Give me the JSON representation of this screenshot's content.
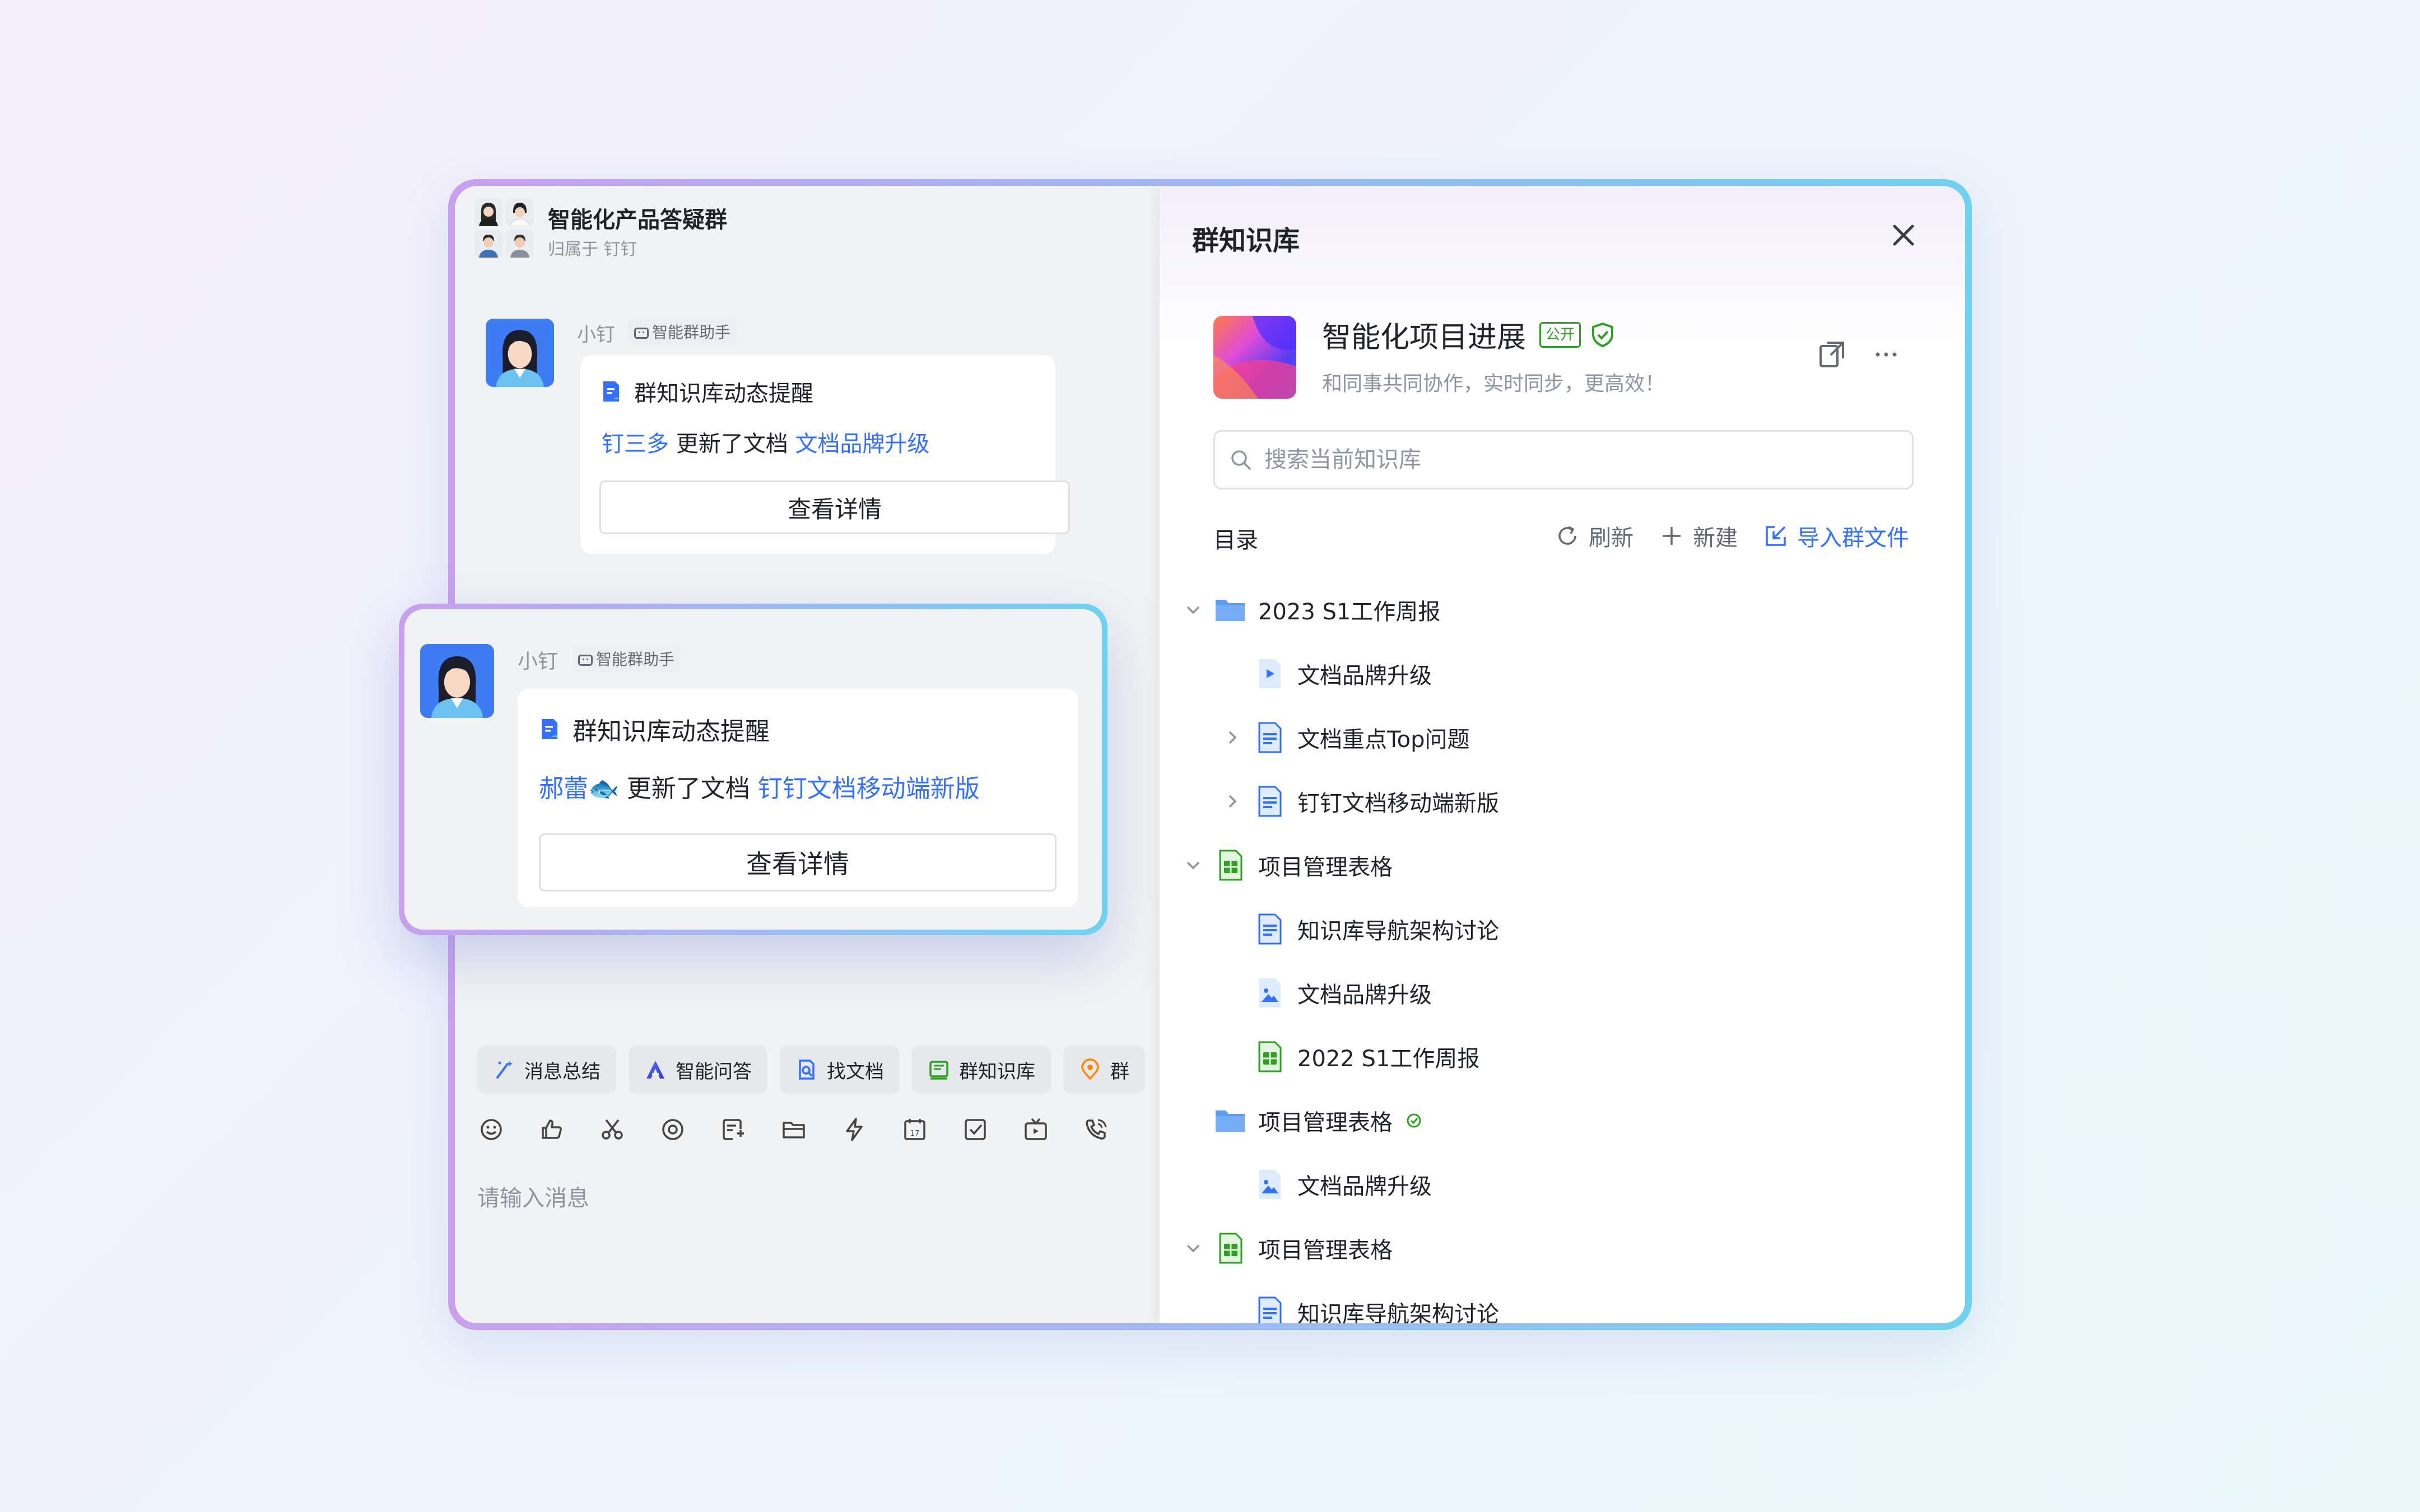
{
  "group": {
    "title": "智能化产品答疑群",
    "subtitle": "归属于 钉钉"
  },
  "messages": [
    {
      "sender": "小钉",
      "bot_tag": "智能群助手",
      "card_title": "群知识库动态提醒",
      "user": "钉三多",
      "action": "更新了文档",
      "doc": "文档品牌升级",
      "button": "查看详情"
    },
    {
      "sender": "小钉",
      "bot_tag": "智能群助手",
      "card_title": "群知识库动态提醒",
      "user": "郝蕾🐟",
      "action": "更新了文档",
      "doc": "钉钉文档移动端新版",
      "button": "查看详情"
    }
  ],
  "quick_actions": [
    {
      "label": "消息总结",
      "icon": "magic-wand-icon"
    },
    {
      "label": "智能问答",
      "icon": "ai-logo-icon"
    },
    {
      "label": "找文档",
      "icon": "doc-search-icon"
    },
    {
      "label": "群知识库",
      "icon": "book-icon"
    },
    {
      "label": "群",
      "icon": "location-pin-icon"
    }
  ],
  "input": {
    "placeholder": "请输入消息"
  },
  "panel": {
    "title": "群知识库",
    "kb": {
      "name": "智能化项目进展",
      "badge": "公开",
      "description": "和同事共同协作，实时同步，更高效！"
    },
    "search_placeholder": "搜索当前知识库",
    "toc_label": "目录",
    "actions": {
      "refresh": "刷新",
      "new": "新建",
      "import": "导入群文件"
    },
    "tree": [
      {
        "label": "2023 S1工作周报",
        "type": "folder",
        "expanded": true
      },
      {
        "label": "文档品牌升级",
        "type": "video"
      },
      {
        "label": "文档重点Top问题",
        "type": "doc",
        "expanded": false
      },
      {
        "label": "钉钉文档移动端新版",
        "type": "doc",
        "expanded": false
      },
      {
        "label": "项目管理表格",
        "type": "sheet",
        "expanded": true
      },
      {
        "label": "知识库导航架构讨论",
        "type": "doc"
      },
      {
        "label": "文档品牌升级",
        "type": "image"
      },
      {
        "label": "2022 S1工作周报",
        "type": "sheet"
      },
      {
        "label": "项目管理表格",
        "type": "folder",
        "synced": true
      },
      {
        "label": "文档品牌升级",
        "type": "image"
      },
      {
        "label": "项目管理表格",
        "type": "sheet",
        "expanded": true
      },
      {
        "label": "知识库导航架构讨论",
        "type": "doc"
      }
    ]
  },
  "colors": {
    "accent_blue": "#3370ff",
    "green": "#2ea121",
    "folder_blue": "#5b9cf5",
    "frame_gradient": [
      "#c8a0ee",
      "#6fd2f0"
    ]
  }
}
